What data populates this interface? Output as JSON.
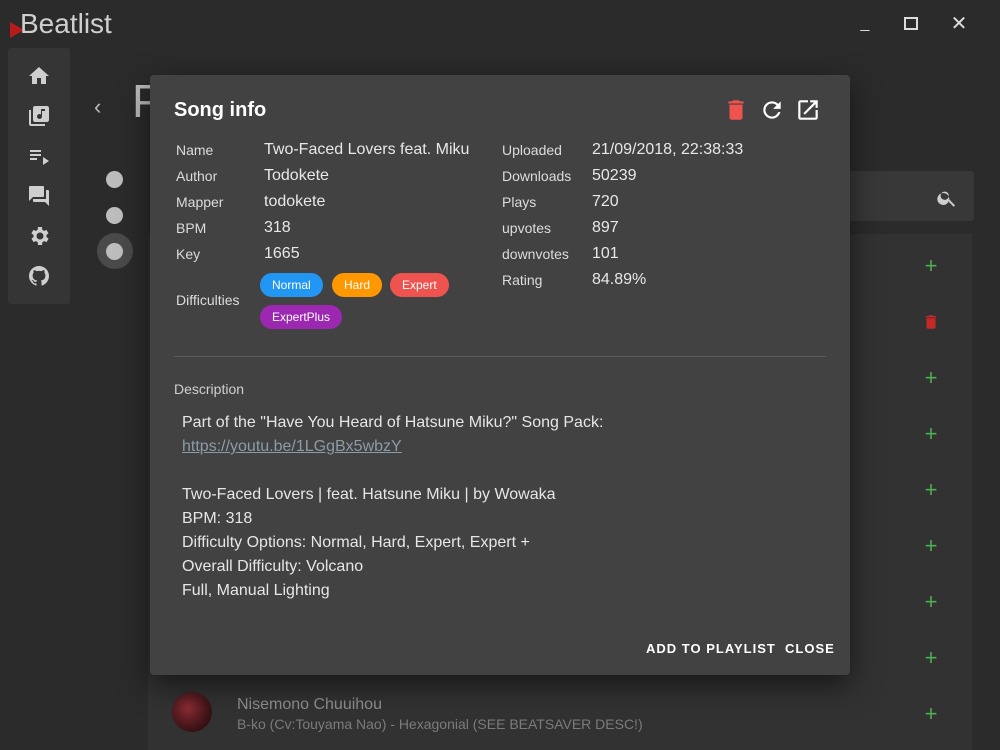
{
  "app": {
    "title": "Beatlist"
  },
  "window_controls": {
    "minimize": "_",
    "close": "✕"
  },
  "background": {
    "page_title_partial": "P",
    "back": "‹"
  },
  "background_song": {
    "title": "Nisemono Chuuihou",
    "subtitle": "B-ko (Cv:Touyama Nao) - Hexagonial (SEE BEATSAVER DESC!)"
  },
  "dialog": {
    "title": "Song info",
    "left_fields": [
      {
        "label": "Name",
        "value": "Two-Faced Lovers feat. Miku"
      },
      {
        "label": "Author",
        "value": "Todokete"
      },
      {
        "label": "Mapper",
        "value": "todokete"
      },
      {
        "label": "BPM",
        "value": "318"
      },
      {
        "label": "Key",
        "value": "1665"
      }
    ],
    "difficulties_label": "Difficulties",
    "difficulties": [
      {
        "name": "Normal",
        "color": "#2196f3"
      },
      {
        "name": "Hard",
        "color": "#ff9800"
      },
      {
        "name": "Expert",
        "color": "#ef5350"
      },
      {
        "name": "ExpertPlus",
        "color": "#9c27b0"
      }
    ],
    "right_fields": [
      {
        "label": "Uploaded",
        "value": "21/09/2018, 22:38:33"
      },
      {
        "label": "Downloads",
        "value": "50239"
      },
      {
        "label": "Plays",
        "value": "720"
      },
      {
        "label": "upvotes",
        "value": "897"
      },
      {
        "label": "downvotes",
        "value": "101"
      },
      {
        "label": "Rating",
        "value": "84.89%"
      }
    ],
    "description_label": "Description",
    "description": {
      "line1": "Part of the \"Have You Heard of Hatsune Miku?\" Song Pack:",
      "link": "https://youtu.be/1LGgBx5wbzY",
      "line3": "Two-Faced Lovers | feat. Hatsune Miku | by Wowaka",
      "line4": "BPM: 318",
      "line5": "Difficulty Options: Normal, Hard, Expert, Expert +",
      "line6": "Overall Difficulty: Volcano",
      "line7": "Full, Manual Lighting"
    },
    "actions": {
      "add_to_playlist": "ADD TO PLAYLIST",
      "close": "CLOSE"
    }
  },
  "colors": {
    "delete": "#ef5350",
    "add": "#4caf50",
    "dialog_bg": "#424242"
  }
}
